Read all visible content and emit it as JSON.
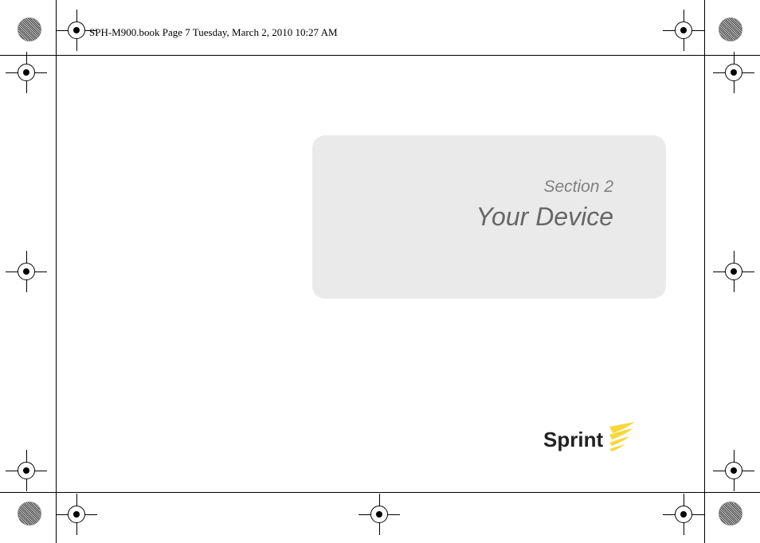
{
  "header": "SPH-M900.book  Page 7  Tuesday, March 2, 2010  10:27 AM",
  "section_label": "Section 2",
  "section_title": "Your Device",
  "logo_text": "Sprint"
}
